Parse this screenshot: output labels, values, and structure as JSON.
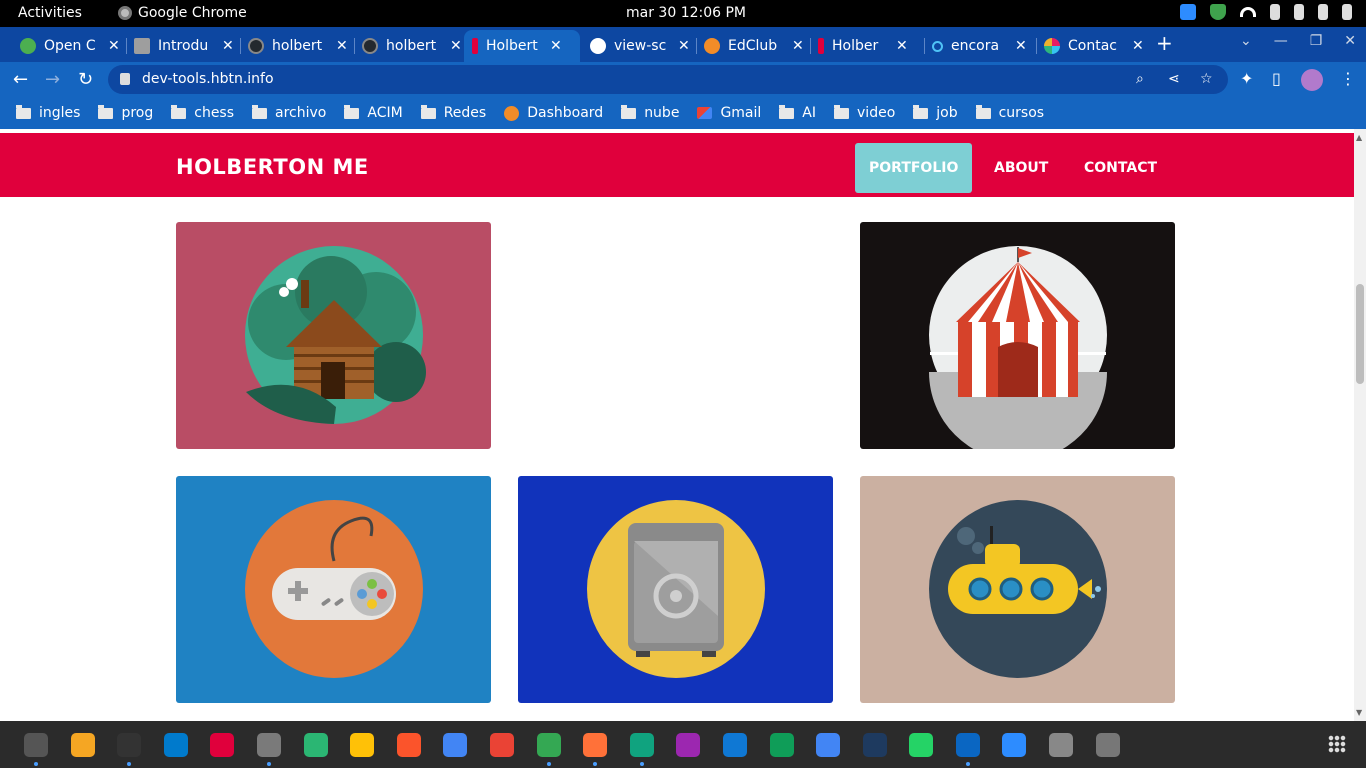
{
  "system_bar": {
    "activities": "Activities",
    "app_name": "Google Chrome",
    "clock": "mar 30  12:06 PM"
  },
  "tabs": [
    {
      "title": "Open C",
      "favicon": "chrome-icon",
      "color": "#4caf50"
    },
    {
      "title": "Introdu",
      "favicon": "book-icon",
      "color": "#9e9e9e"
    },
    {
      "title": "holbert",
      "favicon": "github-icon",
      "color": "#24292e"
    },
    {
      "title": "holbert",
      "favicon": "github-icon",
      "color": "#24292e"
    },
    {
      "title": "Holbert",
      "favicon": "holberton-icon",
      "color": "#e0003c"
    },
    {
      "title": "view-sc",
      "favicon": "globe-icon",
      "color": "#ffffff"
    },
    {
      "title": "EdClub",
      "favicon": "edclub-icon",
      "color": "#f28c28"
    },
    {
      "title": "Holber",
      "favicon": "holberton-icon",
      "color": "#e0003c"
    },
    {
      "title": "encora",
      "favicon": "search-icon",
      "color": "#4fc3f7"
    },
    {
      "title": "Contac",
      "favicon": "slack-icon",
      "color": "#e91e63"
    }
  ],
  "toolbar": {
    "url": "dev-tools.hbtn.info"
  },
  "bookmarks": [
    {
      "label": "ingles",
      "icon": "folder-icon"
    },
    {
      "label": "prog",
      "icon": "folder-icon"
    },
    {
      "label": "chess",
      "icon": "folder-icon"
    },
    {
      "label": "archivo",
      "icon": "folder-icon"
    },
    {
      "label": "ACIM",
      "icon": "folder-icon"
    },
    {
      "label": "Redes",
      "icon": "folder-icon"
    },
    {
      "label": "Dashboard",
      "icon": "dashboard-icon"
    },
    {
      "label": "nube",
      "icon": "folder-icon"
    },
    {
      "label": "Gmail",
      "icon": "gmail-icon"
    },
    {
      "label": "AI",
      "icon": "folder-icon"
    },
    {
      "label": "video",
      "icon": "folder-icon"
    },
    {
      "label": "job",
      "icon": "folder-icon"
    },
    {
      "label": "cursos",
      "icon": "folder-icon"
    }
  ],
  "site": {
    "brand": "HOLBERTON ME",
    "nav": [
      {
        "label": "PORTFOLIO",
        "active": true
      },
      {
        "label": "ABOUT",
        "active": false
      },
      {
        "label": "CONTACT",
        "active": false
      }
    ],
    "accent": "#e0003c",
    "active_nav_color": "#7ecfd4"
  },
  "portfolio": [
    {
      "name": "cabin",
      "bg": "#b94d65",
      "circle": "#3fae93"
    },
    {
      "name": "empty",
      "bg": "#ffffff",
      "circle": ""
    },
    {
      "name": "circus-tent",
      "bg": "#151111",
      "circle": "#eceeee"
    },
    {
      "name": "game-controller",
      "bg": "#1f82c3",
      "circle": "#e2783a"
    },
    {
      "name": "safe",
      "bg": "#1133bb",
      "circle": "#eec444"
    },
    {
      "name": "submarine",
      "bg": "#cbb0a1",
      "circle": "#344859"
    }
  ],
  "dock": [
    {
      "name": "clock-app",
      "color": "#555555",
      "running": true
    },
    {
      "name": "calculator",
      "color": "#f5a623",
      "running": false
    },
    {
      "name": "terminal",
      "color": "#333333",
      "running": true
    },
    {
      "name": "vscode",
      "color": "#007acc",
      "running": false
    },
    {
      "name": "holberton",
      "color": "#e0003c",
      "running": false
    },
    {
      "name": "files",
      "color": "#7a7a7a",
      "running": true
    },
    {
      "name": "edge-dev",
      "color": "#2bb673",
      "running": false
    },
    {
      "name": "notes",
      "color": "#ffc107",
      "running": false
    },
    {
      "name": "brave",
      "color": "#fb542b",
      "running": false
    },
    {
      "name": "calendar",
      "color": "#4285f4",
      "running": false
    },
    {
      "name": "gmail",
      "color": "#ea4335",
      "running": false
    },
    {
      "name": "chrome",
      "color": "#34a853",
      "running": true
    },
    {
      "name": "firefox",
      "color": "#ff7139",
      "running": true
    },
    {
      "name": "chatgpt",
      "color": "#10a37f",
      "running": true
    },
    {
      "name": "chat-bot",
      "color": "#9c27b0",
      "running": false
    },
    {
      "name": "onedrive",
      "color": "#0f78d4",
      "running": false
    },
    {
      "name": "google-drive",
      "color": "#0f9d58",
      "running": false
    },
    {
      "name": "translate",
      "color": "#4285f4",
      "running": false
    },
    {
      "name": "remote",
      "color": "#1e3a5f",
      "running": false
    },
    {
      "name": "whatsapp",
      "color": "#25d366",
      "running": false
    },
    {
      "name": "linkedin",
      "color": "#0a66c2",
      "running": true
    },
    {
      "name": "zoom",
      "color": "#2d8cff",
      "running": false
    },
    {
      "name": "image-viewer",
      "color": "#888888",
      "running": false
    },
    {
      "name": "settings",
      "color": "#777777",
      "running": false
    }
  ]
}
